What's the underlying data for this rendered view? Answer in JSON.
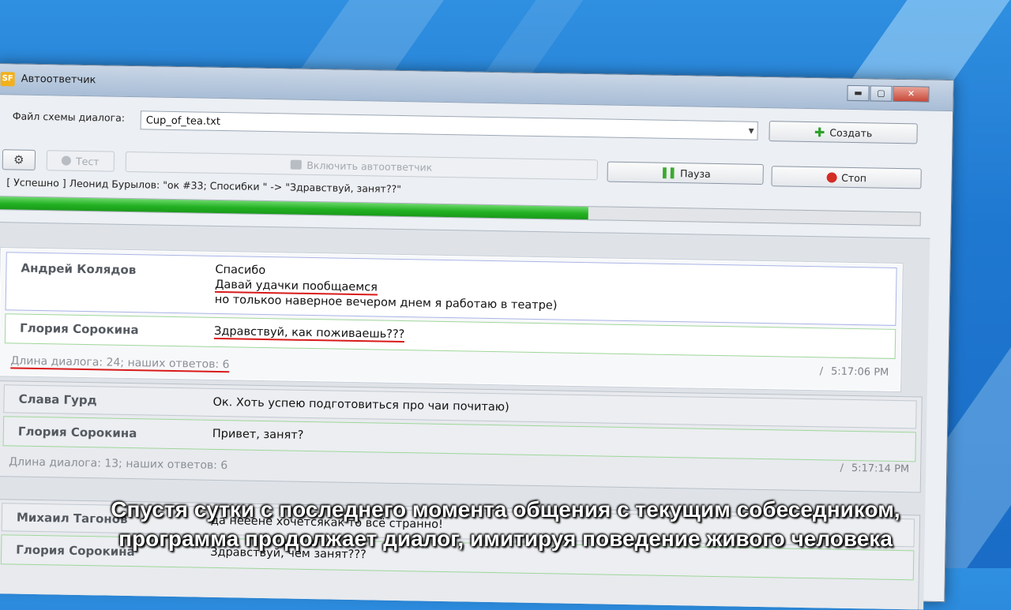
{
  "window": {
    "title": "Автоответчик",
    "icon_text": "SF",
    "controls": {
      "minimize": "▬",
      "maximize": "▢",
      "close": "✕"
    }
  },
  "toolbar": {
    "file_label": "Файл схемы диалога:",
    "file_value": "Cup_of_tea.txt",
    "create_label": "Создать",
    "test_label": "Тест",
    "enable_label": "Включить автоответчик",
    "pause_label": "Пауза",
    "stop_label": "Стоп"
  },
  "status": {
    "text": "[ Успешно ] Леонид Бурылов: \"ок #33; Спосибки \" -> \"Здравствуй, занят??\"",
    "progress": 0.64
  },
  "dialogs": [
    {
      "msg1": {
        "name": "Андрей Колядов",
        "line1": "Спасибо",
        "line2": "Давай удачки пообщаемся",
        "line3": "но толькоо наверное вечером днем я работаю в театре)"
      },
      "msg2": {
        "name": "Глория Сорокина",
        "text": "Здравствуй, как поживаешь???"
      },
      "meta": "Длина диалога: 24; наших ответов: 6",
      "sep": "/",
      "time": "5:17:06 PM"
    },
    {
      "msg1": {
        "name": "Слава Гурд",
        "text": "Ок. Хоть успею подготовиться про чаи почитаю)"
      },
      "msg2": {
        "name": "Глория Сорокина",
        "text": "Привет, занят?"
      },
      "meta": "Длина диалога: 13; наших ответов: 6",
      "sep": "/",
      "time": "5:17:14 PM"
    },
    {
      "msg1": {
        "name": "Михаил Тагонов",
        "text": "да нееене хочетсякак то всё странно!"
      },
      "msg2": {
        "name": "Глория Сорокина",
        "text": "Здравствуй, чем занят???"
      }
    }
  ],
  "subtitles": {
    "line1": "Спустя сутки с последнего момента общения с текущим собеседником,",
    "line2": "программа продолжает диалог, имитируя поведение живого человека"
  },
  "colors": {
    "accent_green": "#22b122",
    "underline_red": "#d91a1a",
    "stop_red": "#d32d24"
  },
  "icons": [
    "app-icon",
    "gear-icon",
    "dot-icon",
    "chat-icon",
    "plus-icon",
    "pause-icon",
    "stop-icon"
  ]
}
